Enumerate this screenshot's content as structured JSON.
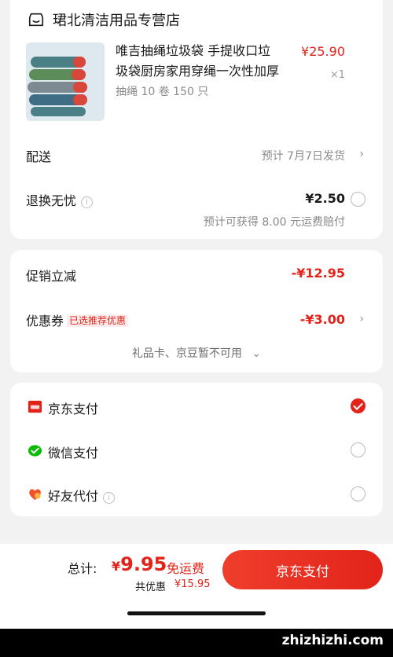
{
  "store": {
    "name": "珺北清洁用品专营店",
    "product": {
      "title": "唯吉抽绳垃圾袋 手提收口垃圾袋厨房家用穿绳一次性加厚",
      "spec": "抽绳 10 卷 150 只",
      "price": "¥25.90",
      "qty": "×1"
    },
    "delivery": {
      "label": "配送",
      "value": "预计 7月7日发货"
    },
    "return": {
      "label": "退换无忧",
      "price": "¥2.50",
      "note": "预计可获得 8.00 元运费赔付"
    }
  },
  "promo": {
    "discount_label": "促销立减",
    "discount_value": "-¥12.95",
    "coupon_label": "优惠券",
    "coupon_tag": "已选推荐优惠",
    "coupon_value": "-¥3.00",
    "giftcard_note": "礼品卡、京豆暂不可用"
  },
  "payment": {
    "options": [
      {
        "label": "京东支付",
        "icon": "jd-pay-icon",
        "selected": true
      },
      {
        "label": "微信支付",
        "icon": "wechat-pay-icon",
        "selected": false
      },
      {
        "label": "好友代付",
        "icon": "friend-pay-icon",
        "selected": false
      }
    ]
  },
  "bottom": {
    "total_label": "总计:",
    "total_currency": "¥",
    "total_amount": "9.95",
    "free_shipping": "免运费",
    "saved_label": "共优惠",
    "saved_amount": "¥15.95",
    "pay_button": "京东支付"
  },
  "watermark": {
    "text": "zhizhizhi.com"
  },
  "colors": {
    "accent": "#e2231a",
    "background": "#f2f2f2",
    "card": "#ffffff"
  }
}
